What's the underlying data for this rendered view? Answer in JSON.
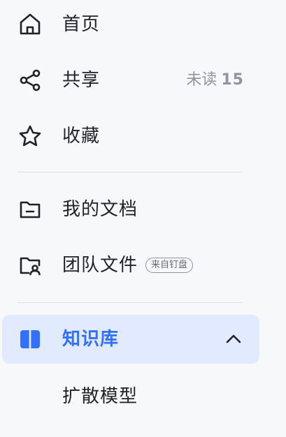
{
  "sidebar": {
    "items": [
      {
        "label": "首页",
        "icon": "home-icon"
      },
      {
        "label": "共享",
        "icon": "share-icon",
        "unread_label": "未读",
        "unread_count": "15"
      },
      {
        "label": "收藏",
        "icon": "star-icon"
      },
      {
        "label": "我的文档",
        "icon": "folder-icon"
      },
      {
        "label": "团队文件",
        "icon": "team-folder-icon",
        "badge": "来自钉盘"
      },
      {
        "label": "知识库",
        "icon": "book-icon",
        "active": true,
        "expanded_icon": "chevron-up-icon"
      }
    ],
    "knowledge_base_children": [
      {
        "label": "扩散模型"
      }
    ]
  },
  "colors": {
    "accent": "#3370ff",
    "active_background": "#e1eaff",
    "text": "#1f2329",
    "muted": "#8f959e",
    "divider": "#dee0e3",
    "background": "#f7f8fa"
  }
}
